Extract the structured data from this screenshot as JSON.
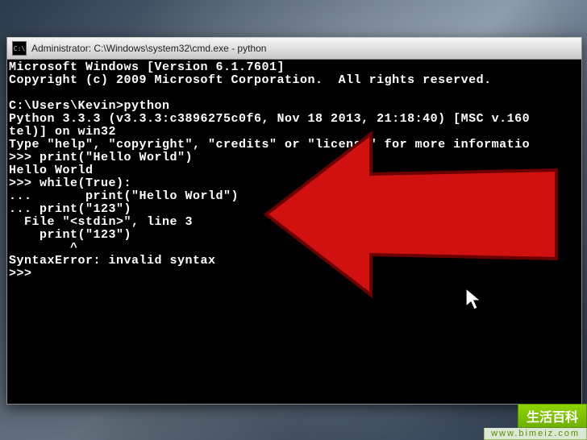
{
  "window": {
    "title": "Administrator: C:\\Windows\\system32\\cmd.exe - python",
    "icon_label": "C:\\"
  },
  "terminal": {
    "lines": [
      "Microsoft Windows [Version 6.1.7601]",
      "Copyright (c) 2009 Microsoft Corporation.  All rights reserved.",
      "",
      "C:\\Users\\Kevin>python",
      "Python 3.3.3 (v3.3.3:c3896275c0f6, Nov 18 2013, 21:18:40) [MSC v.160",
      "tel)] on win32",
      "Type \"help\", \"copyright\", \"credits\" or \"license\" for more informatio",
      ">>> print(\"Hello World\")",
      "Hello World",
      ">>> while(True):",
      "...       print(\"Hello World\")",
      "... print(\"123\")",
      "  File \"<stdin>\", line 3",
      "    print(\"123\")",
      "        ^",
      "SyntaxError: invalid syntax",
      ">>>"
    ]
  },
  "watermark": {
    "brand": "生活百科",
    "url": "www.bimeiz.com"
  }
}
